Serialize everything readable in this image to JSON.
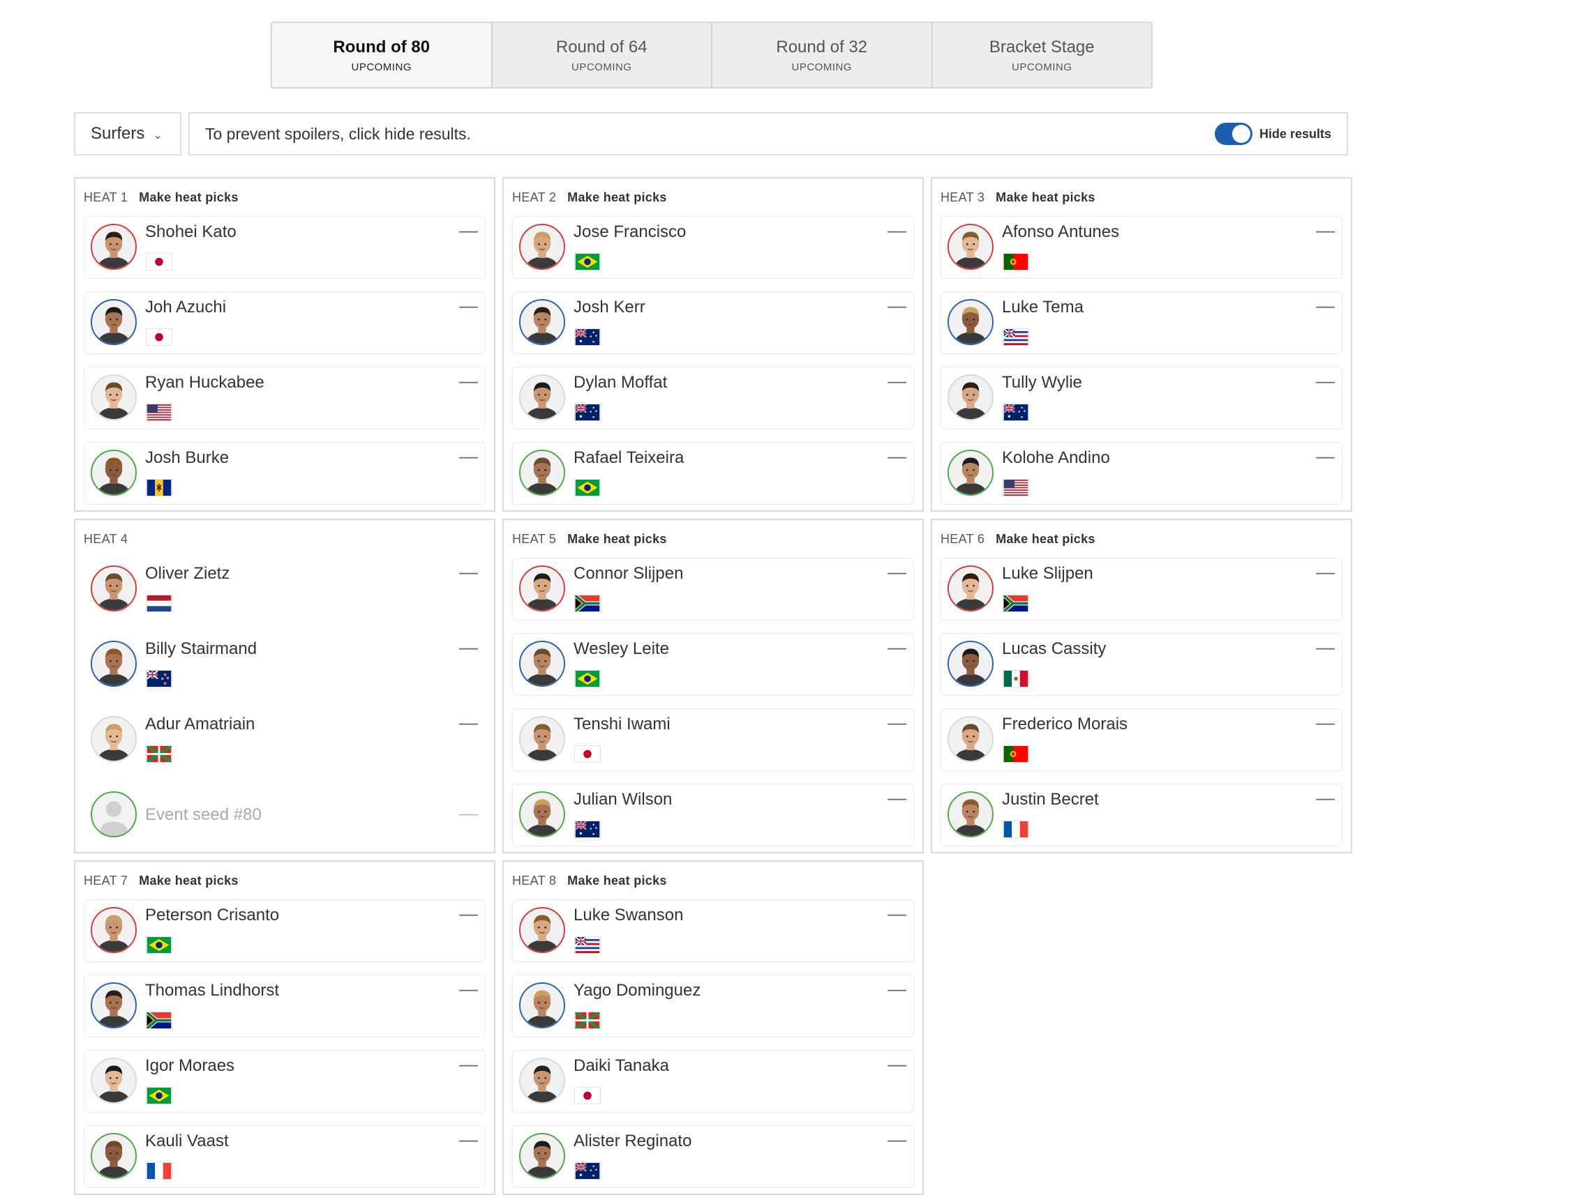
{
  "rounds": [
    {
      "name": "Round of 80",
      "status": "UPCOMING",
      "active": true
    },
    {
      "name": "Round of 64",
      "status": "UPCOMING",
      "active": false
    },
    {
      "name": "Round of 32",
      "status": "UPCOMING",
      "active": false
    },
    {
      "name": "Bracket Stage",
      "status": "UPCOMING",
      "active": false
    }
  ],
  "filter": {
    "view_label": "Surfers",
    "spoiler_message": "To prevent spoilers, click hide results.",
    "hide_results_label": "Hide results",
    "hide_results_on": true
  },
  "colors": {
    "accent": "#1b5fae",
    "seed_red": "#d53b3b",
    "seed_blue": "#2f5fb0",
    "seed_gray": "#d9d9d9",
    "seed_green": "#4ea84a"
  },
  "heats": [
    {
      "label": "HEAT 1",
      "picks_label": "Make heat picks",
      "surfers": [
        {
          "name": "Shohei Kato",
          "country": "japan",
          "score": "––",
          "ring": "red"
        },
        {
          "name": "Joh Azuchi",
          "country": "japan",
          "score": "––",
          "ring": "blue"
        },
        {
          "name": "Ryan Huckabee",
          "country": "usa",
          "score": "––",
          "ring": "gray"
        },
        {
          "name": "Josh Burke",
          "country": "barbados",
          "score": "––",
          "ring": "green"
        }
      ]
    },
    {
      "label": "HEAT 2",
      "picks_label": "Make heat picks",
      "surfers": [
        {
          "name": "Jose Francisco",
          "country": "brazil",
          "score": "––",
          "ring": "red"
        },
        {
          "name": "Josh Kerr",
          "country": "australia",
          "score": "––",
          "ring": "blue"
        },
        {
          "name": "Dylan Moffat",
          "country": "australia",
          "score": "––",
          "ring": "gray"
        },
        {
          "name": "Rafael Teixeira",
          "country": "brazil",
          "score": "––",
          "ring": "green"
        }
      ]
    },
    {
      "label": "HEAT 3",
      "picks_label": "Make heat picks",
      "surfers": [
        {
          "name": "Afonso Antunes",
          "country": "portugal",
          "score": "––",
          "ring": "red"
        },
        {
          "name": "Luke Tema",
          "country": "hawaii",
          "score": "––",
          "ring": "blue"
        },
        {
          "name": "Tully Wylie",
          "country": "australia",
          "score": "––",
          "ring": "gray"
        },
        {
          "name": "Kolohe Andino",
          "country": "usa",
          "score": "––",
          "ring": "green"
        }
      ]
    },
    {
      "label": "HEAT 4",
      "picks_label": "",
      "surfers": [
        {
          "name": "Oliver Zietz",
          "country": "netherlands",
          "score": "––",
          "ring": "red"
        },
        {
          "name": "Billy Stairmand",
          "country": "newzealand",
          "score": "––",
          "ring": "blue"
        },
        {
          "name": "Adur Amatriain",
          "country": "basque",
          "score": "––",
          "ring": "gray"
        },
        {
          "name": "Event seed #80",
          "country": "",
          "score": "––",
          "ring": "green",
          "placeholder": true
        }
      ]
    },
    {
      "label": "HEAT 5",
      "picks_label": "Make heat picks",
      "surfers": [
        {
          "name": "Connor Slijpen",
          "country": "southafrica",
          "score": "––",
          "ring": "red"
        },
        {
          "name": "Wesley Leite",
          "country": "brazil",
          "score": "––",
          "ring": "blue"
        },
        {
          "name": "Tenshi Iwami",
          "country": "japan",
          "score": "––",
          "ring": "gray"
        },
        {
          "name": "Julian Wilson",
          "country": "australia",
          "score": "––",
          "ring": "green"
        }
      ]
    },
    {
      "label": "HEAT 6",
      "picks_label": "Make heat picks",
      "surfers": [
        {
          "name": "Luke Slijpen",
          "country": "southafrica",
          "score": "––",
          "ring": "red"
        },
        {
          "name": "Lucas Cassity",
          "country": "mexico",
          "score": "––",
          "ring": "blue"
        },
        {
          "name": "Frederico Morais",
          "country": "portugal",
          "score": "––",
          "ring": "gray"
        },
        {
          "name": "Justin Becret",
          "country": "france",
          "score": "––",
          "ring": "green"
        }
      ]
    },
    {
      "label": "HEAT 7",
      "picks_label": "Make heat picks",
      "surfers": [
        {
          "name": "Peterson Crisanto",
          "country": "brazil",
          "score": "––",
          "ring": "red"
        },
        {
          "name": "Thomas Lindhorst",
          "country": "southafrica",
          "score": "––",
          "ring": "blue"
        },
        {
          "name": "Igor Moraes",
          "country": "brazil",
          "score": "––",
          "ring": "gray"
        },
        {
          "name": "Kauli Vaast",
          "country": "france",
          "score": "––",
          "ring": "green"
        }
      ]
    },
    {
      "label": "HEAT 8",
      "picks_label": "Make heat picks",
      "surfers": [
        {
          "name": "Luke Swanson",
          "country": "hawaii",
          "score": "––",
          "ring": "red"
        },
        {
          "name": "Yago Dominguez",
          "country": "basque",
          "score": "––",
          "ring": "blue"
        },
        {
          "name": "Daiki Tanaka",
          "country": "japan",
          "score": "––",
          "ring": "gray"
        },
        {
          "name": "Alister Reginato",
          "country": "australia",
          "score": "––",
          "ring": "green"
        }
      ]
    }
  ]
}
